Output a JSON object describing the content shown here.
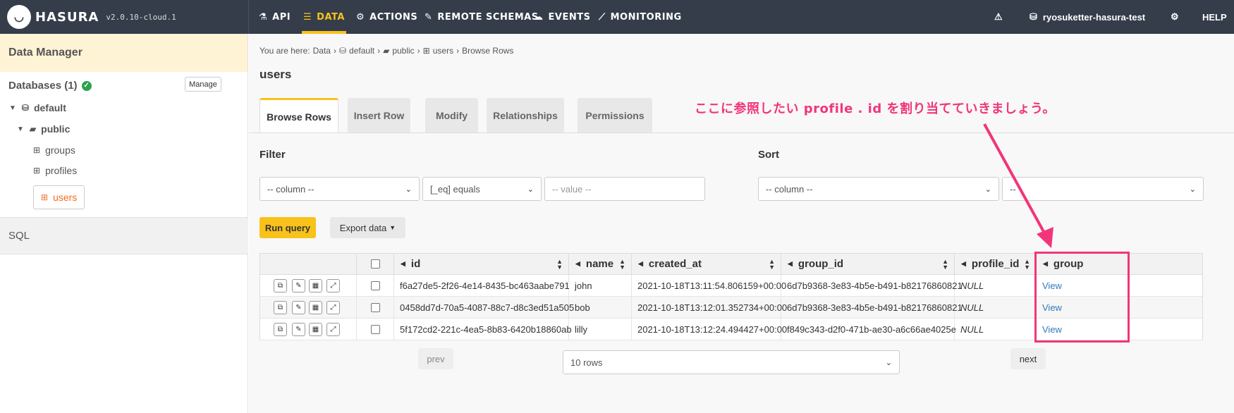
{
  "header": {
    "brand": "HASURA",
    "version": "v2.0.10-cloud.1",
    "nav": [
      {
        "label": "API",
        "icon": "flask-icon"
      },
      {
        "label": "DATA",
        "icon": "database-icon",
        "active": true
      },
      {
        "label": "ACTIONS",
        "icon": "cogs-icon"
      },
      {
        "label": "REMOTE SCHEMAS",
        "icon": "plug-icon"
      },
      {
        "label": "EVENTS",
        "icon": "cloud-icon"
      },
      {
        "label": "MONITORING",
        "icon": "chart-line-icon"
      }
    ],
    "project": "ryosuketter-hasura-test",
    "help": "HELP"
  },
  "sidebar": {
    "title": "Data Manager",
    "databases_label": "Databases (1)",
    "manage_label": "Manage",
    "db_name": "default",
    "schema_name": "public",
    "tables": [
      "groups",
      "profiles",
      "users"
    ],
    "selected_table": "users",
    "sql_label": "SQL"
  },
  "breadcrumb": {
    "prefix": "You are here:",
    "items": [
      "Data",
      "default",
      "public",
      "users",
      "Browse Rows"
    ]
  },
  "page_title": "users",
  "tabs": [
    "Browse Rows",
    "Insert Row",
    "Modify",
    "Relationships",
    "Permissions"
  ],
  "filter": {
    "label": "Filter",
    "column_placeholder": "-- column --",
    "operator": "[_eq] equals",
    "value_placeholder": "-- value --"
  },
  "sort": {
    "label": "Sort",
    "column_placeholder": "-- column --",
    "order_placeholder": "--"
  },
  "buttons": {
    "run_query": "Run query",
    "export": "Export data"
  },
  "table": {
    "columns": [
      "id",
      "name",
      "created_at",
      "group_id",
      "profile_id",
      "group"
    ],
    "rows": [
      {
        "id": "f6a27de5-2f26-4e14-8435-bc463aabe791",
        "name": "john",
        "created_at": "2021-10-18T13:11:54.806159+00:00",
        "group_id": "6d7b9368-3e83-4b5e-b491-b82176860821",
        "profile_id": "NULL",
        "group": "View"
      },
      {
        "id": "0458dd7d-70a5-4087-88c7-d8c3ed51a505",
        "name": "bob",
        "created_at": "2021-10-18T13:12:01.352734+00:00",
        "group_id": "6d7b9368-3e83-4b5e-b491-b82176860821",
        "profile_id": "NULL",
        "group": "View"
      },
      {
        "id": "5f172cd2-221c-4ea5-8b83-6420b18860ab",
        "name": "lilly",
        "created_at": "2021-10-18T13:12:24.494427+00:00",
        "group_id": "f849c343-d2f0-471b-ae30-a6c66ae4025e",
        "profile_id": "NULL",
        "group": "View"
      }
    ]
  },
  "pagination": {
    "prev": "prev",
    "rows_per_page": "10 rows",
    "next": "next"
  },
  "annotation": {
    "text": "ここに参照したい profile . id を割り当てていきましょう。",
    "color": "#f2357a"
  },
  "colors": {
    "accent": "#f8c21a",
    "nav_bg": "#353d4a",
    "link": "#337ab7",
    "selected": "#f26d21"
  }
}
